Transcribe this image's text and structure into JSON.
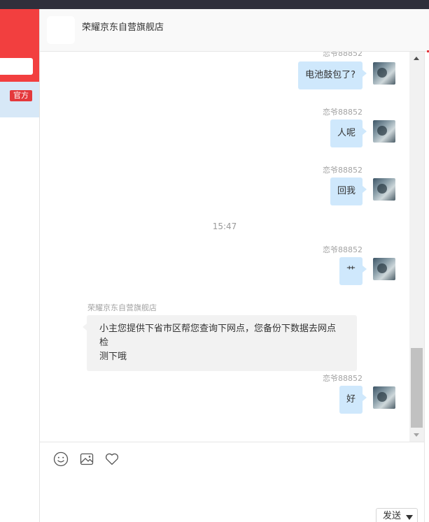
{
  "left_panel": {
    "badge": "官方"
  },
  "header": {
    "shop_name": "荣耀京东自营旗舰店"
  },
  "messages": [
    {
      "nick": "恋爷88852",
      "text": "电池鼓包了?"
    },
    {
      "nick": "恋爷88852",
      "text": "人呢"
    },
    {
      "nick": "恋爷88852",
      "text": "回我"
    },
    {
      "time": "15:47"
    },
    {
      "nick": "恋爷88852",
      "text": "艹"
    },
    {
      "nick": "荣耀京东自营旗舰店",
      "line1": "小主您提供下省市区帮您查询下网点，您备份下数据去网点检",
      "line2": "测下哦"
    },
    {
      "nick": "恋爷88852",
      "text": "好"
    }
  ],
  "toolbar": {
    "emoji_icon": "smile-icon",
    "image_icon": "image-icon",
    "favorite_icon": "heart-icon"
  },
  "send_button": {
    "label": "发送"
  },
  "colors": {
    "brand_red": "#f23f3f",
    "bubble_self": "#cfe8fc",
    "bubble_other": "#f2f2f2",
    "topbar": "#2f2f3b"
  }
}
